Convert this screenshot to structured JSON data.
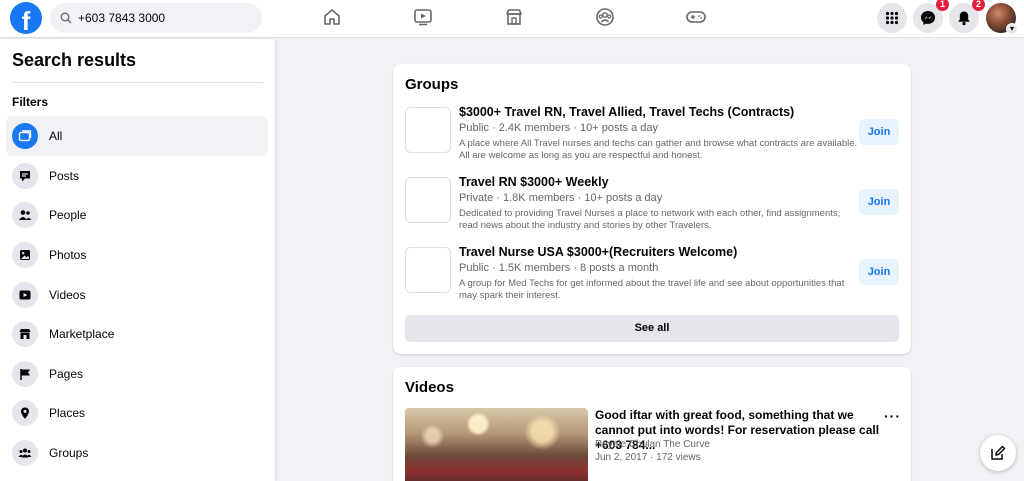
{
  "search": {
    "value": "+603 7843 3000"
  },
  "header": {
    "nav": [
      "home-icon",
      "watch-icon",
      "marketplace-icon",
      "groups-icon",
      "gaming-icon"
    ],
    "messenger_badge": "1",
    "notifications_badge": "2"
  },
  "sidebar": {
    "title": "Search results",
    "filters_label": "Filters",
    "items": [
      {
        "label": "All",
        "icon": "all-icon",
        "active": true
      },
      {
        "label": "Posts",
        "icon": "posts-icon"
      },
      {
        "label": "People",
        "icon": "people-icon"
      },
      {
        "label": "Photos",
        "icon": "photos-icon"
      },
      {
        "label": "Videos",
        "icon": "videos-icon"
      },
      {
        "label": "Marketplace",
        "icon": "marketplace-icon"
      },
      {
        "label": "Pages",
        "icon": "pages-icon"
      },
      {
        "label": "Places",
        "icon": "places-icon"
      },
      {
        "label": "Groups",
        "icon": "groups-icon"
      }
    ]
  },
  "groups": {
    "title": "Groups",
    "items": [
      {
        "name": "$3000+ Travel RN, Travel Allied, Travel Techs (Contracts)",
        "meta": "Public · 2.4K members · 10+ posts a day",
        "description": "A place where All Travel nurses and techs can gather and browse what contracts are available. All are welcome as long as you are respectful and honest.",
        "button": "Join"
      },
      {
        "name": "Travel RN $3000+ Weekly",
        "meta": "Private · 1.8K members · 10+ posts a day",
        "description": "Dedicated to providing Travel Nurses a place to network with each other, find assignments, read news about the industry and stories by other Travelers.",
        "button": "Join"
      },
      {
        "name": "Travel Nurse USA $3000+(Recruiters Welcome)",
        "meta": "Public · 1.5K members · 8 posts a month",
        "description": "A group for Med Techs for get informed about the travel life and see about opportunities that may spark their interest.",
        "button": "Join"
      }
    ],
    "see_all": "See all"
  },
  "videos": {
    "title": "Videos",
    "item": {
      "title": "Good iftar with great food, something that we cannot put into words! For reservation please call +603 784...",
      "source": "Royale Chulan The Curve",
      "meta": "Jun 2, 2017 · 172 views",
      "more": "···"
    }
  },
  "colors": {
    "brand": "#1877f2",
    "badge": "#e41e3f",
    "join_bg": "#e7f3ff"
  }
}
